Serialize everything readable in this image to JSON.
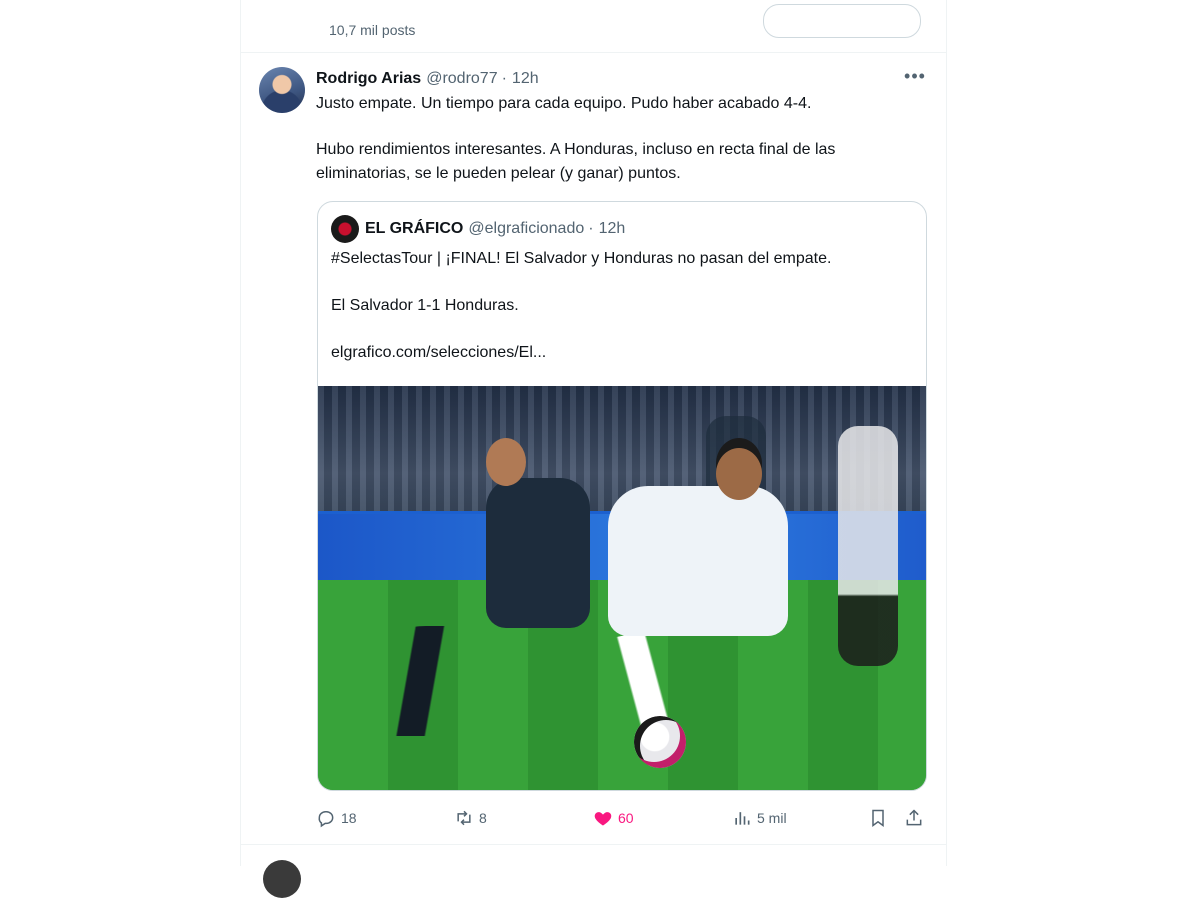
{
  "previous_tweet": {
    "stats_text": "10,7 mil posts"
  },
  "tweet": {
    "author_name": "Rodrigo Arias",
    "author_handle": "@rodro77",
    "separator": "·",
    "time": "12h",
    "more_label": "•••",
    "paragraphs": [
      "Justo empate. Un tiempo para cada equipo. Pudo haber acabado 4-4.",
      "Hubo rendimientos interesantes. A Honduras, incluso en recta final de las eliminatorias, se le pueden pelear (y ganar) puntos."
    ],
    "quote": {
      "author_name": "EL GRÁFICO",
      "author_handle": "@elgraficionado",
      "separator": "·",
      "time": "12h",
      "paragraphs": [
        "#SelectasTour | ¡FINAL! El Salvador y Honduras no pasan del empate.",
        "El Salvador 1-1 Honduras.",
        "elgrafico.com/selecciones/El..."
      ]
    },
    "actions": {
      "replies": "18",
      "reposts": "8",
      "likes": "60",
      "views": "5 mil"
    },
    "icons": {
      "reply": "reply-icon",
      "repost": "repost-icon",
      "like": "heart-icon",
      "views": "views-icon",
      "bookmark": "bookmark-icon",
      "share": "share-icon"
    },
    "colors": {
      "like_active": "#f91880",
      "muted_text": "#536471",
      "primary_text": "#0f1419",
      "border": "#cfd9de"
    }
  }
}
